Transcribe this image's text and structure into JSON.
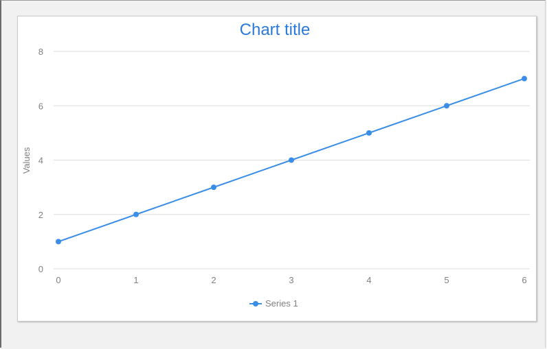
{
  "chart_data": {
    "type": "line",
    "title": "Chart title",
    "xlabel": "",
    "ylabel": "Values",
    "x": [
      0,
      1,
      2,
      3,
      4,
      5,
      6
    ],
    "xticks": [
      "0",
      "1",
      "2",
      "3",
      "4",
      "5",
      "6"
    ],
    "yticks": [
      "0",
      "2",
      "4",
      "6",
      "8"
    ],
    "xlim": [
      0,
      6
    ],
    "ylim": [
      0,
      8
    ],
    "grid": "horizontal",
    "legend_position": "bottom",
    "series": [
      {
        "name": "Series 1",
        "values": [
          1,
          2,
          3,
          4,
          5,
          6,
          7
        ],
        "color": "#3a8ee6"
      }
    ],
    "colors": {
      "title": "#2a7ad8",
      "grid": "#dedede",
      "tick_text": "#808080"
    }
  }
}
